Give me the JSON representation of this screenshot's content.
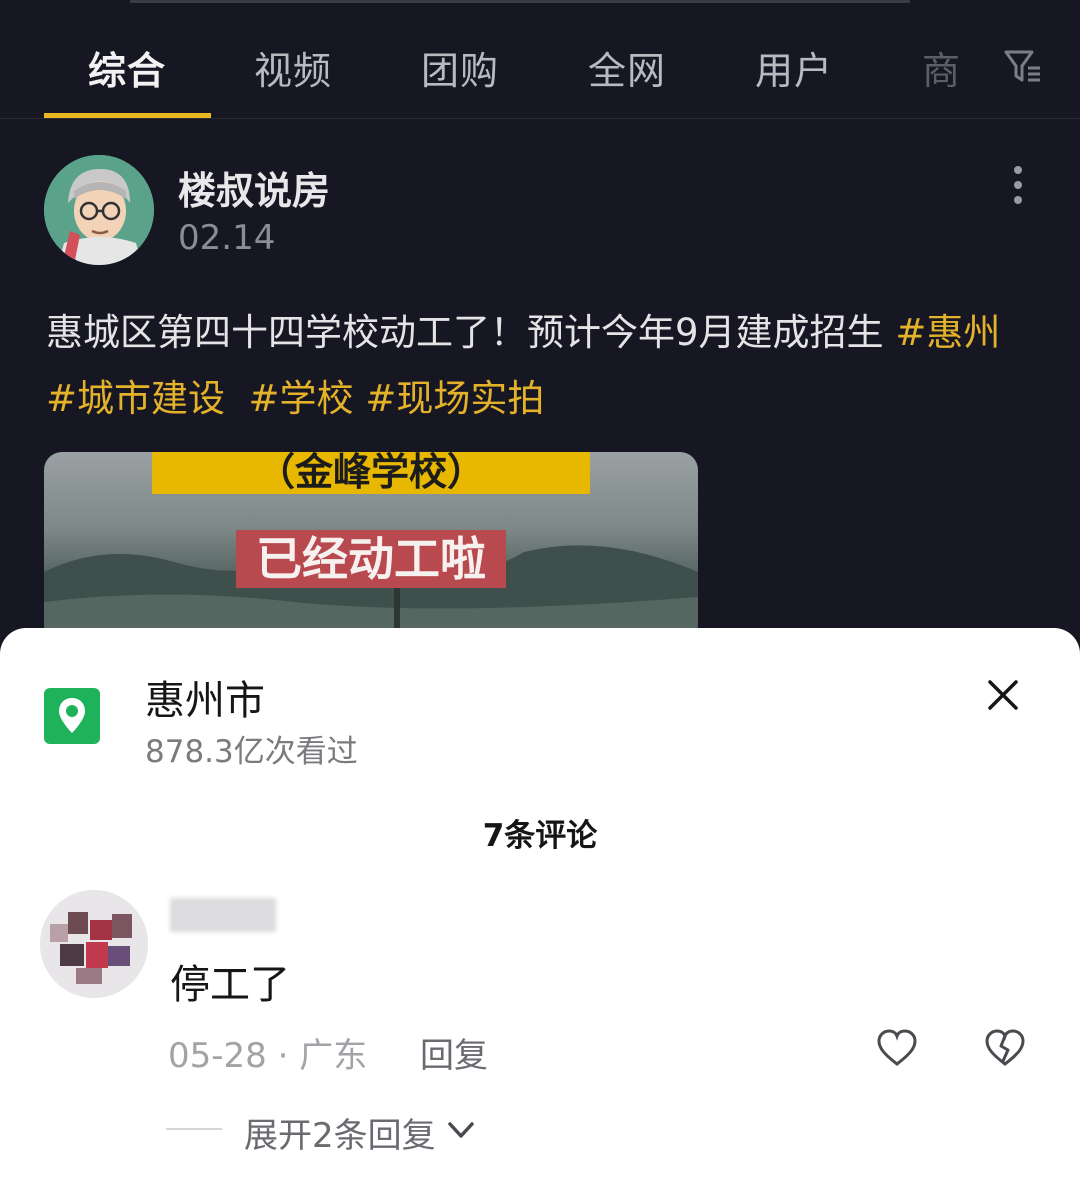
{
  "tabs": [
    {
      "label": "综合",
      "active": true
    },
    {
      "label": "视频"
    },
    {
      "label": "团购"
    },
    {
      "label": "全网"
    },
    {
      "label": "用户"
    },
    {
      "label": "商"
    }
  ],
  "post": {
    "author": "楼叔说房",
    "date": "02.14",
    "text_plain": "惠城区第四十四学校动工了！预计今年9月建成招生 ",
    "tags": [
      "#惠州",
      "#城市建设",
      "#学校",
      "#现场实拍"
    ],
    "thumb_caption_1": "（金峰学校）",
    "thumb_caption_2": "已经动工啦"
  },
  "sheet": {
    "location_name": "惠州市",
    "views": "878.3亿次看过",
    "comment_count": "7条评论",
    "comment": {
      "text": "停工了",
      "date": "05-28",
      "separator": " · ",
      "region": "广东",
      "reply_label": "回复",
      "expand_label": "展开2条回复"
    }
  },
  "colors": {
    "background": "#161722",
    "accent": "#e9b71f",
    "tag": "#e3b22a",
    "location": "#1eb35a"
  }
}
